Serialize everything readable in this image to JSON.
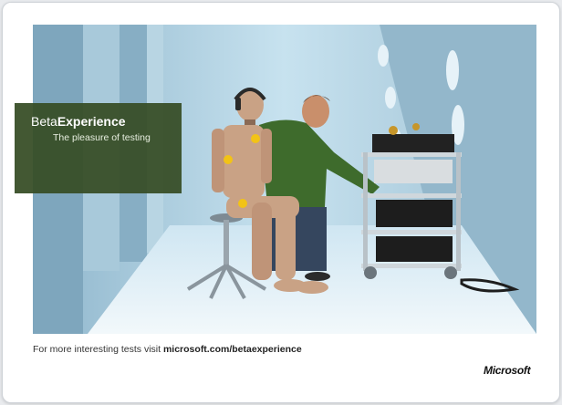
{
  "banner": {
    "title_light": "Beta",
    "title_bold": "Experience",
    "subtitle": "The pleasure of testing"
  },
  "footer": {
    "prefix": "For more interesting tests visit ",
    "url": "microsoft.com/betaexperience"
  },
  "brand": {
    "logo_text": "Microsoft"
  },
  "colors": {
    "banner_bg": "#374e26",
    "photo_bg": "#bcd7e6",
    "floor": "#dceef7",
    "shirt": "#3e6b2c",
    "dummy": "#c9a285"
  },
  "photo": {
    "description_icon": "crash-test-photo"
  }
}
